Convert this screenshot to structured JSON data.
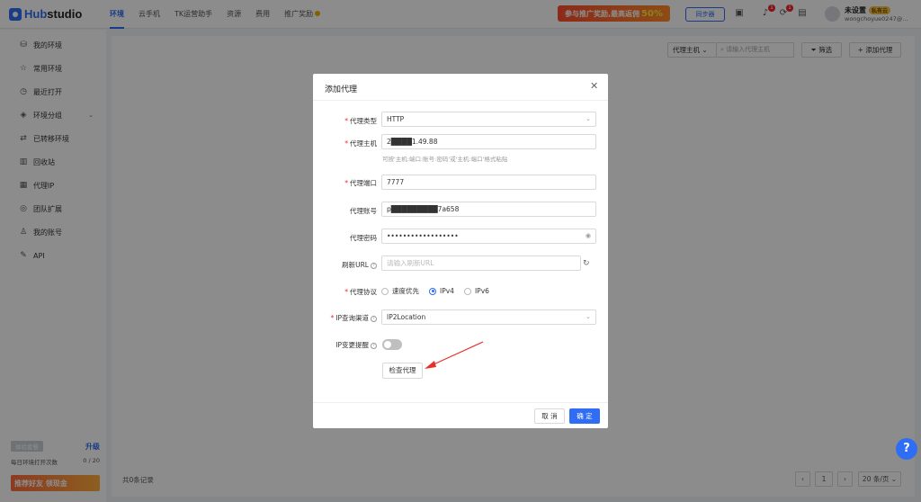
{
  "app": {
    "logo_prefix": "Hub",
    "logo_suffix": "studio"
  },
  "topnav": [
    {
      "label": "环境"
    },
    {
      "label": "云手机"
    },
    {
      "label": "TK运营助手"
    },
    {
      "label": "资源"
    },
    {
      "label": "费用"
    },
    {
      "label": "推广奖励"
    }
  ],
  "header": {
    "promo_text": "参与推广奖励,最高返佣",
    "promo_value": "50%",
    "sync_label": "同步器",
    "notify_count": "1",
    "task_count": "1",
    "user_name": "未设置",
    "user_tag": "私有云",
    "user_mail": "wongchoyue0247@..."
  },
  "sidebar": {
    "items": [
      {
        "label": "我的环境",
        "icon": "database-icon"
      },
      {
        "label": "常用环境",
        "icon": "star-icon"
      },
      {
        "label": "最近打开",
        "icon": "clock-icon"
      },
      {
        "label": "环境分组",
        "icon": "layers-icon"
      },
      {
        "label": "已转移环境",
        "icon": "transfer-icon"
      },
      {
        "label": "回收站",
        "icon": "trash-icon"
      },
      {
        "label": "代理IP",
        "icon": "proxy-icon"
      },
      {
        "label": "团队扩展",
        "icon": "team-icon"
      },
      {
        "label": "我的账号",
        "icon": "user-icon"
      },
      {
        "label": "API",
        "icon": "api-icon"
      }
    ],
    "trial_label": "体验套餐",
    "upgrade_label": "升级",
    "open_count_label": "每日环境打开次数",
    "open_count_value": "0 / 20",
    "invite_label": "推荐好友 领现金"
  },
  "main": {
    "proxy_host_select": "代理主机",
    "search_placeholder": "请输入代理主机",
    "filter_label": "筛选",
    "add_proxy_label": "添加代理",
    "total_records": "共0条记录",
    "page_number": "1",
    "page_size": "20 条/页"
  },
  "modal": {
    "title": "添加代理",
    "fields": {
      "proxy_type_label": "代理类型",
      "proxy_type_value": "HTTP",
      "proxy_host_label": "代理主机",
      "proxy_host_value": "2████1.49.88",
      "proxy_host_hint": "可按'主机:端口:账号:密码'或'主机:端口'格式粘贴",
      "proxy_port_label": "代理端口",
      "proxy_port_value": "7777",
      "proxy_account_label": "代理账号",
      "proxy_account_value": "p█████████7a658",
      "proxy_password_label": "代理密码",
      "proxy_password_value": "••••••••••••••••••",
      "refresh_url_label": "刷新URL",
      "refresh_url_placeholder": "请输入刷新URL",
      "protocol_label": "代理协议",
      "protocol_options": [
        "速度优先",
        "IPv4",
        "IPv6"
      ],
      "protocol_selected": "IPv4",
      "ip_channel_label": "IP查询渠道",
      "ip_channel_value": "IP2Location",
      "ip_change_label": "IP变更提醒",
      "ip_change_enabled": false
    },
    "check_proxy_label": "检查代理",
    "cancel_label": "取 消",
    "ok_label": "确 定"
  },
  "help_fab": "?",
  "colors": {
    "accent": "#2f6df5",
    "required": "#f5222d",
    "promo": "#ff4d2e"
  }
}
